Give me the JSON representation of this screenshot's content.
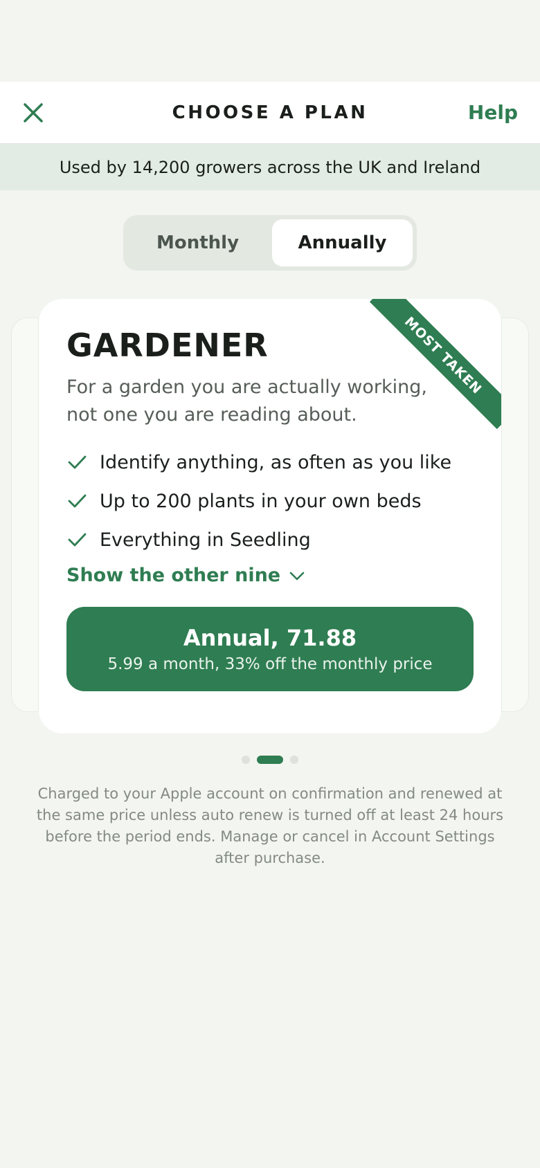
{
  "nav": {
    "title": "CHOOSE A PLAN",
    "help_label": "Help",
    "close_icon": "close-icon"
  },
  "banner": {
    "text": "Used by 14,200 growers across the UK and Ireland"
  },
  "billing_toggle": {
    "options": [
      "Monthly",
      "Annually"
    ],
    "selected": "Annually"
  },
  "plan": {
    "badge": "MOST TAKEN",
    "name": "GARDENER",
    "description": "For a garden you are actually working, not one you are reading about.",
    "features": [
      "Identify anything, as often as you like",
      "Up to 200 plants in your own beds",
      "Everything in Seedling"
    ],
    "show_more_label": "Show the other nine",
    "cta": {
      "title": "Annual, 71.88",
      "subtitle": "5.99 a month, 33% off the monthly price"
    }
  },
  "pager": {
    "count": 3,
    "active_index": 1
  },
  "legal": "Charged to your Apple account on confirmation and renewed at the same price unless auto renew is turned off at least 24 hours before the period ends. Manage or cancel in Account Settings after purchase.",
  "colors": {
    "accent": "#2f7d52",
    "background": "#f3f5f0",
    "banner": "#e2ece4"
  }
}
